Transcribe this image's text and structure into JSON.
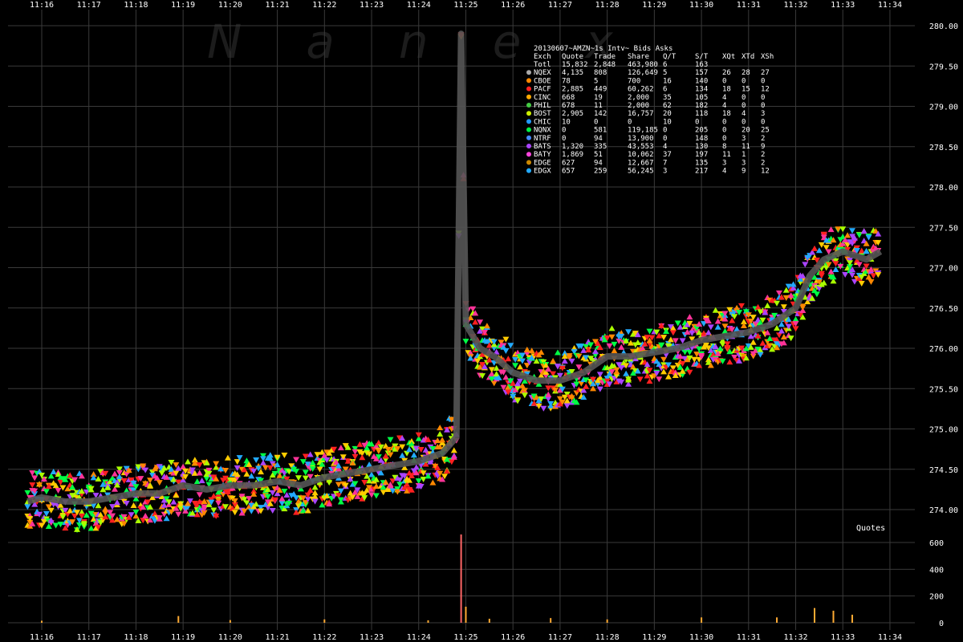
{
  "chart_data": {
    "type": "scatter",
    "title": "20130607~AMZN~1s Intv~ Bids Asks",
    "watermark": "Nanex",
    "x_ticks": [
      "11:16",
      "11:17",
      "11:18",
      "11:19",
      "11:20",
      "11:21",
      "11:22",
      "11:23",
      "11:24",
      "11:25",
      "11:26",
      "11:27",
      "11:28",
      "11:29",
      "11:30",
      "11:31",
      "11:32",
      "11:33",
      "11:34"
    ],
    "price_axis": {
      "ylim": [
        273.6,
        280.2
      ],
      "ticks": [
        "280.00",
        "279.50",
        "279.00",
        "278.50",
        "278.00",
        "277.50",
        "277.00",
        "276.50",
        "276.00",
        "275.50",
        "275.00",
        "274.50",
        "274.00"
      ],
      "tick_values": [
        280.0,
        279.5,
        279.0,
        278.5,
        278.0,
        277.5,
        277.0,
        276.5,
        276.0,
        275.5,
        275.0,
        274.5,
        274.0
      ],
      "label": "Quotes"
    },
    "volume_axis": {
      "ylim": [
        0,
        700
      ],
      "ticks": [
        "600",
        "400",
        "200",
        "0"
      ],
      "tick_values": [
        600,
        400,
        200,
        0
      ]
    },
    "mid_series": [
      {
        "t": "11:15.7",
        "p": 274.1
      },
      {
        "t": "11:16",
        "p": 274.15
      },
      {
        "t": "11:16.5",
        "p": 274.1
      },
      {
        "t": "11:17",
        "p": 274.1
      },
      {
        "t": "11:17.5",
        "p": 274.15
      },
      {
        "t": "11:18",
        "p": 274.2
      },
      {
        "t": "11:18.5",
        "p": 274.2
      },
      {
        "t": "11:19",
        "p": 274.3
      },
      {
        "t": "11:19.5",
        "p": 274.25
      },
      {
        "t": "11:20",
        "p": 274.3
      },
      {
        "t": "11:20.5",
        "p": 274.3
      },
      {
        "t": "11:21",
        "p": 274.35
      },
      {
        "t": "11:21.5",
        "p": 274.3
      },
      {
        "t": "11:22",
        "p": 274.4
      },
      {
        "t": "11:22.5",
        "p": 274.45
      },
      {
        "t": "11:23",
        "p": 274.5
      },
      {
        "t": "11:23.5",
        "p": 274.55
      },
      {
        "t": "11:24",
        "p": 274.6
      },
      {
        "t": "11:24.5",
        "p": 274.7
      },
      {
        "t": "11:24.8",
        "p": 274.9
      },
      {
        "t": "11:24.9",
        "p": 279.9
      },
      {
        "t": "11:25",
        "p": 276.3
      },
      {
        "t": "11:25.3",
        "p": 276.0
      },
      {
        "t": "11:25.6",
        "p": 275.9
      },
      {
        "t": "11:26",
        "p": 275.7
      },
      {
        "t": "11:26.5",
        "p": 275.6
      },
      {
        "t": "11:27",
        "p": 275.6
      },
      {
        "t": "11:27.5",
        "p": 275.7
      },
      {
        "t": "11:28",
        "p": 275.9
      },
      {
        "t": "11:28.5",
        "p": 275.9
      },
      {
        "t": "11:29",
        "p": 275.95
      },
      {
        "t": "11:29.5",
        "p": 276.0
      },
      {
        "t": "11:30",
        "p": 276.1
      },
      {
        "t": "11:30.5",
        "p": 276.15
      },
      {
        "t": "11:31",
        "p": 276.2
      },
      {
        "t": "11:31.5",
        "p": 276.3
      },
      {
        "t": "11:32",
        "p": 276.5
      },
      {
        "t": "11:32.3",
        "p": 276.9
      },
      {
        "t": "11:32.6",
        "p": 277.1
      },
      {
        "t": "11:33",
        "p": 277.2
      },
      {
        "t": "11:33.5",
        "p": 277.1
      },
      {
        "t": "11:33.8",
        "p": 277.2
      }
    ],
    "volume_spikes": [
      {
        "t": "11:16",
        "v": 15
      },
      {
        "t": "11:18.9",
        "v": 50
      },
      {
        "t": "11:20",
        "v": 20
      },
      {
        "t": "11:22",
        "v": 25
      },
      {
        "t": "11:24.2",
        "v": 18
      },
      {
        "t": "11:24.9",
        "v": 660
      },
      {
        "t": "11:25",
        "v": 120
      },
      {
        "t": "11:25.5",
        "v": 30
      },
      {
        "t": "11:26.8",
        "v": 35
      },
      {
        "t": "11:28",
        "v": 25
      },
      {
        "t": "11:30",
        "v": 40
      },
      {
        "t": "11:31.6",
        "v": 40
      },
      {
        "t": "11:32.4",
        "v": 110
      },
      {
        "t": "11:32.8",
        "v": 90
      },
      {
        "t": "11:33.2",
        "v": 60
      }
    ],
    "legend": {
      "header": [
        "Exch",
        "Quote",
        "Trade",
        "Share",
        "Q/T",
        "S/T",
        "XQt",
        "XTd",
        "XSh"
      ],
      "rows": [
        {
          "name": "Totl",
          "quote": "15,832",
          "trade": "2,848",
          "share": "463,980",
          "qt": "6",
          "st": "163",
          "xqt": "",
          "xtd": "",
          "xsh": "",
          "color": ""
        },
        {
          "name": "NQEX",
          "quote": "4,135",
          "trade": "808",
          "share": "126,649",
          "qt": "5",
          "st": "157",
          "xqt": "26",
          "xtd": "28",
          "xsh": "27",
          "color": "#aaaaaa"
        },
        {
          "name": "CBOE",
          "quote": "78",
          "trade": "5",
          "share": "700",
          "qt": "16",
          "st": "140",
          "xqt": "0",
          "xtd": "0",
          "xsh": "0",
          "color": "#ff8800"
        },
        {
          "name": "PACF",
          "quote": "2,885",
          "trade": "449",
          "share": "60,262",
          "qt": "6",
          "st": "134",
          "xqt": "18",
          "xtd": "15",
          "xsh": "12",
          "color": "#ff2020"
        },
        {
          "name": "CINC",
          "quote": "668",
          "trade": "19",
          "share": "2,000",
          "qt": "35",
          "st": "105",
          "xqt": "4",
          "xtd": "0",
          "xsh": "0",
          "color": "#ffaa00"
        },
        {
          "name": "PHIL",
          "quote": "678",
          "trade": "11",
          "share": "2,000",
          "qt": "62",
          "st": "182",
          "xqt": "4",
          "xtd": "0",
          "xsh": "0",
          "color": "#44cc44"
        },
        {
          "name": "BOST",
          "quote": "2,905",
          "trade": "142",
          "share": "16,757",
          "qt": "20",
          "st": "118",
          "xqt": "18",
          "xtd": "4",
          "xsh": "3",
          "color": "#ccee00"
        },
        {
          "name": "CHIC",
          "quote": "10",
          "trade": "0",
          "share": "0",
          "qt": "10",
          "st": "0",
          "xqt": "0",
          "xtd": "0",
          "xsh": "0",
          "color": "#2299ff"
        },
        {
          "name": "NQNX",
          "quote": "0",
          "trade": "581",
          "share": "119,185",
          "qt": "0",
          "st": "205",
          "xqt": "0",
          "xtd": "20",
          "xsh": "25",
          "color": "#00ee44"
        },
        {
          "name": "NTRF",
          "quote": "0",
          "trade": "94",
          "share": "13,900",
          "qt": "0",
          "st": "148",
          "xqt": "0",
          "xtd": "3",
          "xsh": "2",
          "color": "#4488ff"
        },
        {
          "name": "BATS",
          "quote": "1,320",
          "trade": "335",
          "share": "43,553",
          "qt": "4",
          "st": "130",
          "xqt": "8",
          "xtd": "11",
          "xsh": "9",
          "color": "#aa44ff"
        },
        {
          "name": "BATY",
          "quote": "1,869",
          "trade": "51",
          "share": "10,062",
          "qt": "37",
          "st": "197",
          "xqt": "11",
          "xtd": "1",
          "xsh": "2",
          "color": "#ff44dd"
        },
        {
          "name": "EDGE",
          "quote": "627",
          "trade": "94",
          "share": "12,667",
          "qt": "7",
          "st": "135",
          "xqt": "3",
          "xtd": "3",
          "xsh": "2",
          "color": "#cc8800"
        },
        {
          "name": "EDGX",
          "quote": "657",
          "trade": "259",
          "share": "56,245",
          "qt": "3",
          "st": "217",
          "xqt": "4",
          "xtd": "9",
          "xsh": "12",
          "color": "#22aaff"
        }
      ]
    },
    "colors": {
      "background": "#000000",
      "grid": "#3a3a3a",
      "text": "#ffffff",
      "spread": "#555555",
      "quote_palette": [
        "#aaff00",
        "#ff3399",
        "#ff2020",
        "#00ff44",
        "#ffcc00",
        "#aa44ff",
        "#22aaff",
        "#ff8800"
      ]
    }
  }
}
